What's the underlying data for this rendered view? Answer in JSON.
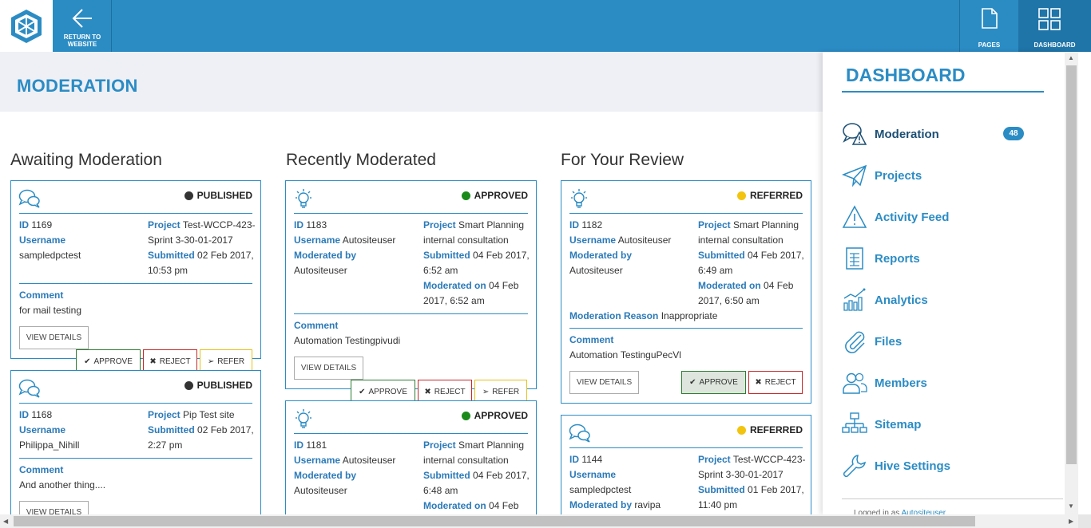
{
  "topbar": {
    "return_label": "RETURN TO\nWEBSITE",
    "pages_label": "PAGES",
    "dashboard_label": "DASHBOARD",
    "color": "#2b8cc4"
  },
  "page": {
    "title": "MODERATION"
  },
  "columns": {
    "awaiting": {
      "title": "Awaiting Moderation"
    },
    "recent": {
      "title": "Recently Moderated"
    },
    "review": {
      "title": "For Your Review"
    }
  },
  "labels": {
    "id": "ID",
    "username": "Username",
    "project": "Project",
    "submitted": "Submitted",
    "moderated_by": "Moderated by",
    "moderated_on": "Moderated on",
    "moderation_reason": "Moderation Reason",
    "comment": "Comment",
    "view_details": "VIEW DETAILS",
    "approve": "APPROVE",
    "reject": "REJECT",
    "refer": "REFER"
  },
  "awaiting_cards": [
    {
      "status": "PUBLISHED",
      "status_color": "#333333",
      "id": "1169",
      "username": "sampledpctest",
      "project_line1": "Test-WCCP-423-",
      "project_line2": "Sprint 3-30-01-2017",
      "submitted_line1": "02 Feb 2017,",
      "submitted_line2": "10:53 pm",
      "comment": "for mail testing"
    },
    {
      "status": "PUBLISHED",
      "status_color": "#333333",
      "id": "1168",
      "username": "Philippa_Nihill",
      "project_line1": "Pip Test site",
      "submitted_line1": "02 Feb 2017,",
      "submitted_line2": "2:27 pm",
      "comment": "And another thing...."
    }
  ],
  "recent_cards": [
    {
      "status": "APPROVED",
      "status_color": "#1a8a1a",
      "id": "1183",
      "username": "Autositeuser",
      "moderated_by": "Autositeuser",
      "project_line1": "Smart Planning",
      "project_line2": "internal consultation",
      "submitted_line1": "04 Feb 2017,",
      "submitted_line2": "6:52 am",
      "moderated_on_line1": "04 Feb",
      "moderated_on_line2": "2017, 6:52 am",
      "comment": "Automation Testingpivudi"
    },
    {
      "status": "APPROVED",
      "status_color": "#1a8a1a",
      "id": "1181",
      "username": "Autositeuser",
      "moderated_by": "Autositeuser",
      "project_line1": "Smart Planning",
      "project_line2": "internal consultation",
      "submitted_line1": "04 Feb 2017,",
      "submitted_line2": "6:48 am",
      "moderated_on_line1": "04 Feb"
    }
  ],
  "review_cards": [
    {
      "status": "REFERRED",
      "status_color": "#f2c40f",
      "id": "1182",
      "username": "Autositeuser",
      "moderated_by": "Autositeuser",
      "project_line1": "Smart Planning",
      "project_line2": "internal consultation",
      "submitted_line1": "04 Feb 2017,",
      "submitted_line2": "6:49 am",
      "moderated_on_line1": "04 Feb",
      "moderated_on_line2": "2017, 6:50 am",
      "moderation_reason": "Inappropriate",
      "comment": "Automation TestinguPecVl"
    },
    {
      "status": "REFERRED",
      "status_color": "#f2c40f",
      "id": "1144",
      "username": "sampledpctest",
      "moderated_by": "ravipa",
      "project_line1": "Test-WCCP-423-",
      "project_line2": "Sprint 3-30-01-2017",
      "submitted_line1": "01 Feb 2017,",
      "submitted_line2": "11:40 pm"
    }
  ],
  "sidebar": {
    "title": "DASHBOARD",
    "items": [
      {
        "label": "Moderation",
        "icon": "moderation-icon",
        "badge": "48"
      },
      {
        "label": "Projects",
        "icon": "paper-plane-icon"
      },
      {
        "label": "Activity Feed",
        "icon": "warning-icon"
      },
      {
        "label": "Reports",
        "icon": "report-icon"
      },
      {
        "label": "Analytics",
        "icon": "analytics-icon"
      },
      {
        "label": "Files",
        "icon": "paperclip-icon"
      },
      {
        "label": "Members",
        "icon": "members-icon"
      },
      {
        "label": "Sitemap",
        "icon": "sitemap-icon"
      },
      {
        "label": "Hive Settings",
        "icon": "wrench-icon"
      }
    ],
    "logged_in_prefix": "Logged in as",
    "logged_in_user": "Autositeuser"
  }
}
